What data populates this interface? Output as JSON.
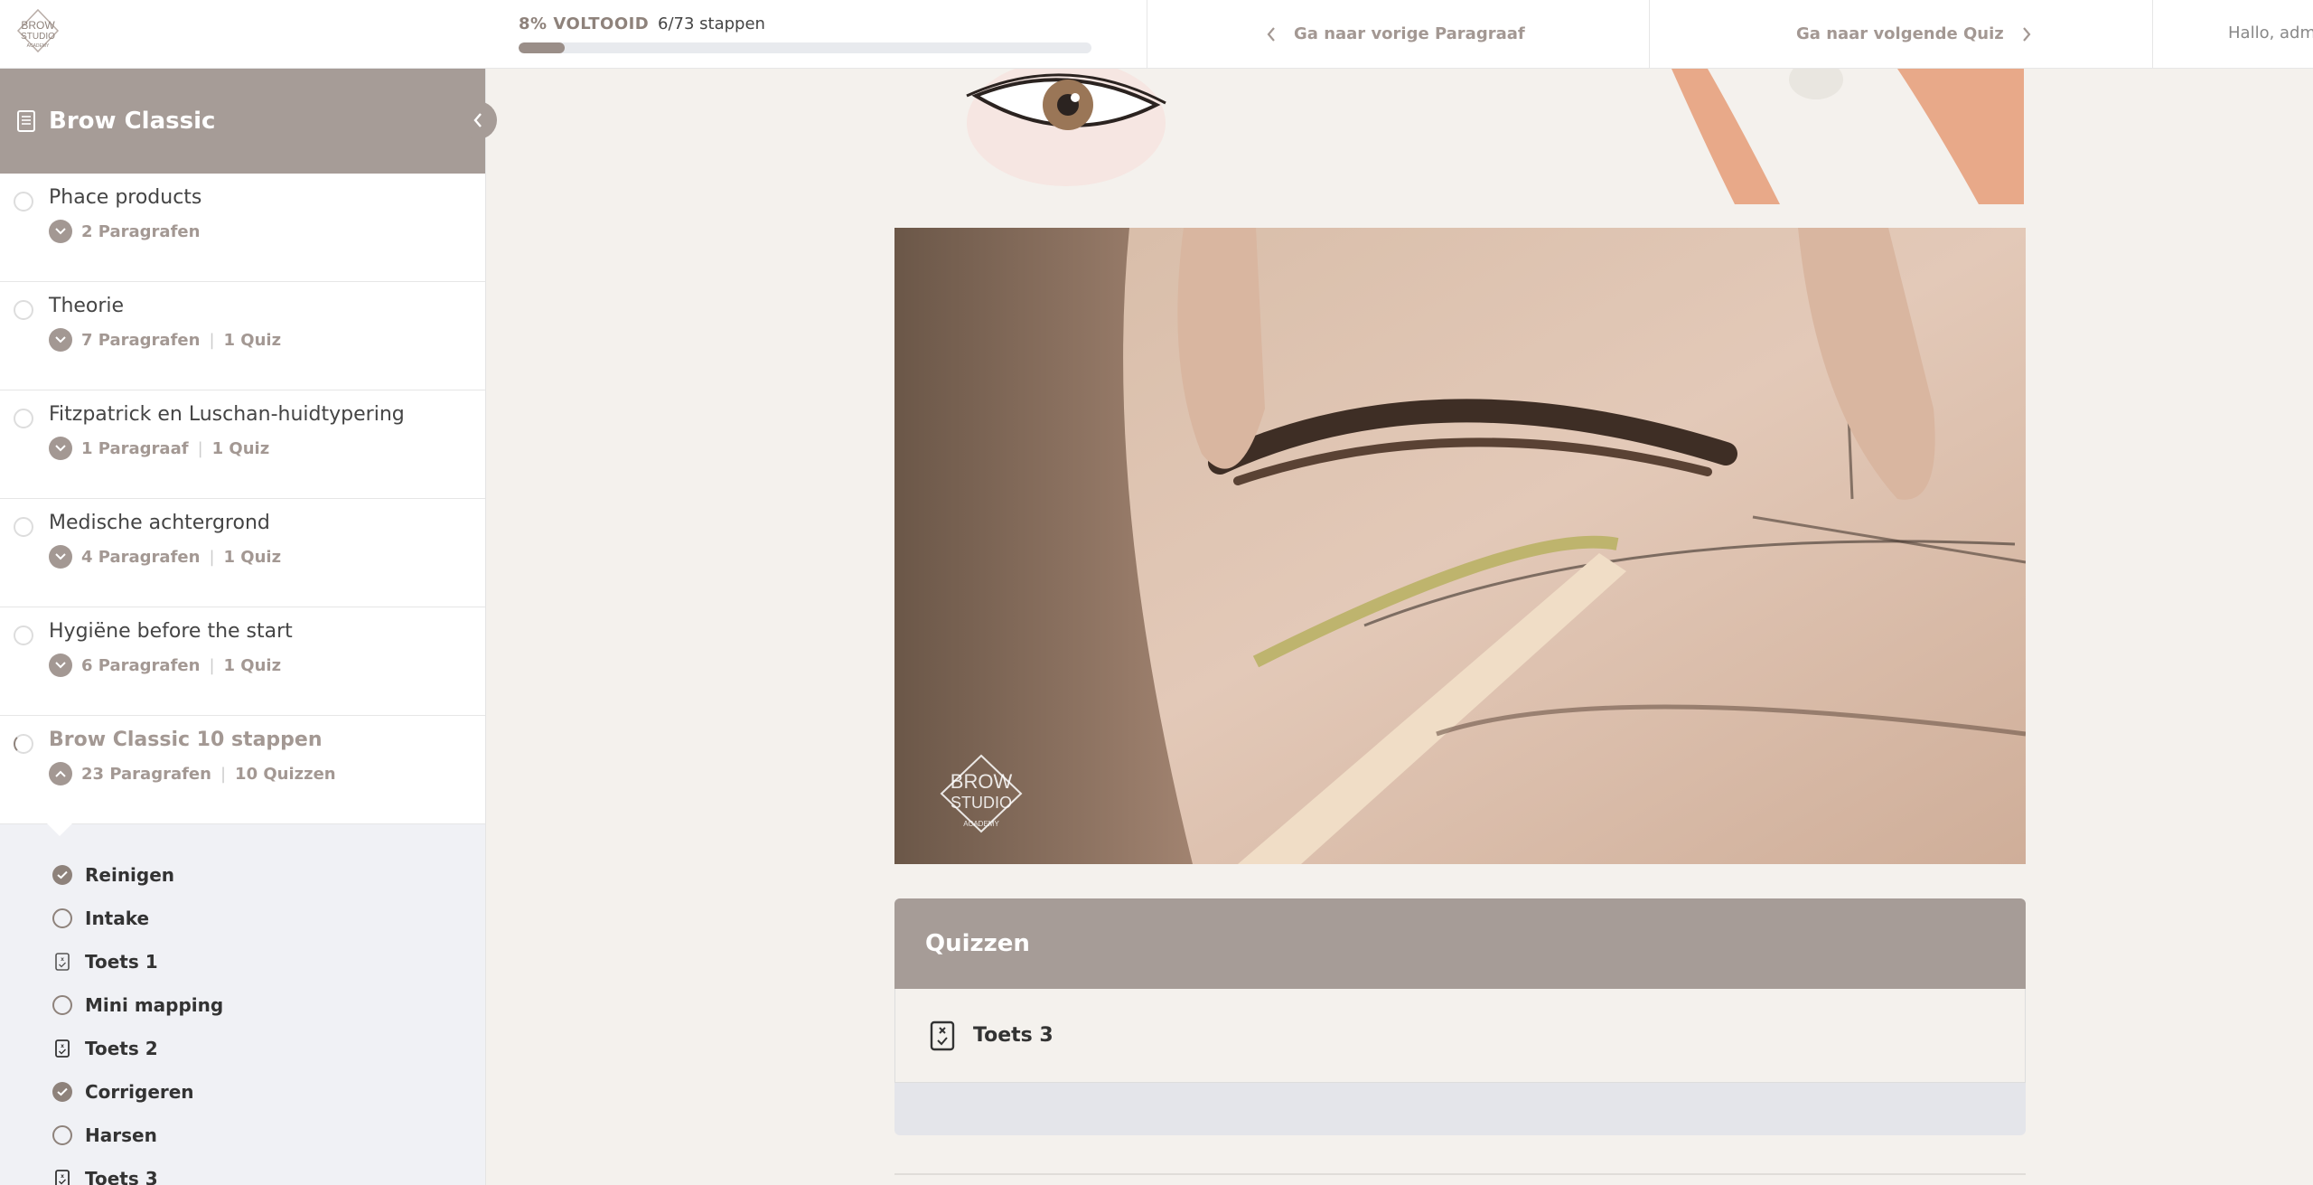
{
  "header": {
    "logo_text": "BROW STUDIO ACADEMY",
    "progress_percent_label": "8% VOLTOOID",
    "progress_steps_label": "6/73 stappen",
    "progress_value": 0.08,
    "prev_label": "Ga naar vorige Paragraaf",
    "next_label": "Ga naar volgende Quiz",
    "greeting": "Hallo, adm"
  },
  "sidebar": {
    "title": "Brow Classic",
    "sections": [
      {
        "name": "Phace products",
        "lessons": "2 Paragrafen",
        "quiz": ""
      },
      {
        "name": "Theorie",
        "lessons": "7 Paragrafen",
        "quiz": "1 Quiz"
      },
      {
        "name": "Fitzpatrick en Luschan-huidtypering",
        "lessons": "1 Paragraaf",
        "quiz": "1 Quiz"
      },
      {
        "name": "Medische achtergrond",
        "lessons": "4 Paragrafen",
        "quiz": "1 Quiz"
      },
      {
        "name": "Hygiëne before the start",
        "lessons": "6 Paragrafen",
        "quiz": "1 Quiz"
      },
      {
        "name": "Brow Classic 10 stappen",
        "lessons": "23 Paragrafen",
        "quiz": "10 Quizzen"
      }
    ],
    "sub_items": [
      {
        "label": "Reinigen",
        "type": "done"
      },
      {
        "label": "Intake",
        "type": "open"
      },
      {
        "label": "Toets 1",
        "type": "quiz"
      },
      {
        "label": "Mini mapping",
        "type": "open"
      },
      {
        "label": "Toets 2",
        "type": "quiz"
      },
      {
        "label": "Corrigeren",
        "type": "done"
      },
      {
        "label": "Harsen",
        "type": "open"
      },
      {
        "label": "Toets 3",
        "type": "quiz"
      }
    ]
  },
  "main": {
    "photo_watermark": "BROW STUDIO ACADEMY",
    "quiz_heading": "Quizzen",
    "quiz_item": "Toets 3"
  },
  "colors": {
    "accent": "#a69c97",
    "accent_dark": "#8e827b",
    "background": "#f4f1ed"
  }
}
